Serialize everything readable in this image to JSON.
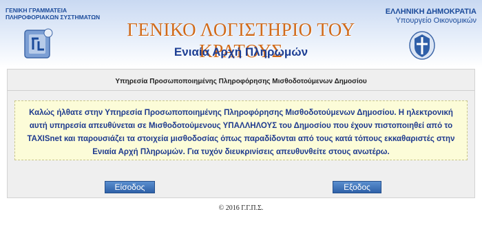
{
  "header": {
    "left_org_line1": "ΓΕΝΙΚΗ ΓΡΑΜΜΑΤΕΙΑ",
    "left_org_line2": "ΠΛΗΡΟΦΟΡΙΑΚΩΝ ΣΥΣΤΗΜΑΤΩΝ",
    "left_logo_icon": "gsis-logo-icon",
    "title": "ΓΕΝΙΚΟ ΛΟΓΙΣΤΗΡΙΟ ΤΟΥ ΚΡΑΤΟΥΣ",
    "subtitle": "Ενιαία Αρχή Πληρωμών",
    "right_line1": "ΕΛΛΗΝΙΚΗ ΔΗΜΟΚΡΑΤΙΑ",
    "right_line2": "Υπουργείο Οικονομικών",
    "right_emblem_icon": "greek-emblem-icon"
  },
  "panel": {
    "title": "Υπηρεσία Προσωποποιημένης Πληροφόρησης Μισθοδοτούμενων Δημοσίου",
    "notice": "Καλώς ήλθατε στην Υπηρεσία Προσωποποιημένης Πληροφόρησης Μισθοδοτούμενων Δημοσίου. Η ηλεκτρονική αυτή υπηρεσία απευθύνεται σε Μισθοδοτούμενους ΥΠΑΛΛΗΛΟΥΣ του Δημοσίου που έχουν πιστοποιηθεί από το TAXISnet και παρουσιάζει τα στοιχεία μισθοδοσίας όπως παραδίδονται από τους κατά τόπους εκκαθαριστές στην Ενιαία Αρχή Πληρωμών. Για τυχόν διευκρινίσεις απευθυνθείτε στους ανωτέρω."
  },
  "buttons": {
    "login": "Είσοδος",
    "logout": "Εξοδος"
  },
  "footer": {
    "copyright": "© 2016 Γ.Γ.Π.Σ."
  },
  "colors": {
    "header_blue": "#1a4a9a",
    "title_orange": "#d06a1a",
    "notice_bg": "#fcfcd8",
    "button_blue": "#2f61a8"
  }
}
